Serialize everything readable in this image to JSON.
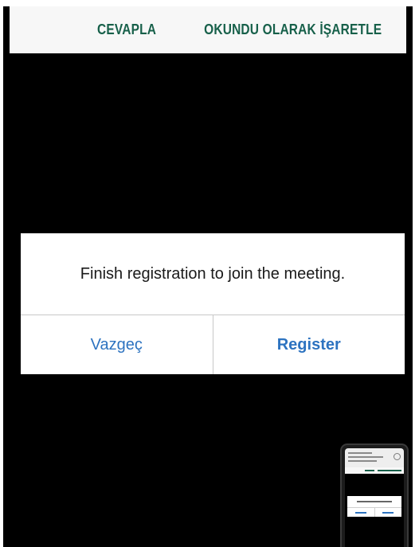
{
  "notification": {
    "reply_label": "CEVAPLA",
    "mark_read_label": "OKUNDU OLARAK İŞARETLE"
  },
  "dialog": {
    "message": "Finish registration to join the meeting.",
    "cancel_label": "Vazgeç",
    "register_label": "Register"
  },
  "colors": {
    "action_green": "#17604a",
    "button_blue": "#2d73c0",
    "backdrop": "#000000"
  },
  "icons": {
    "pip": "video-thumbnail"
  }
}
